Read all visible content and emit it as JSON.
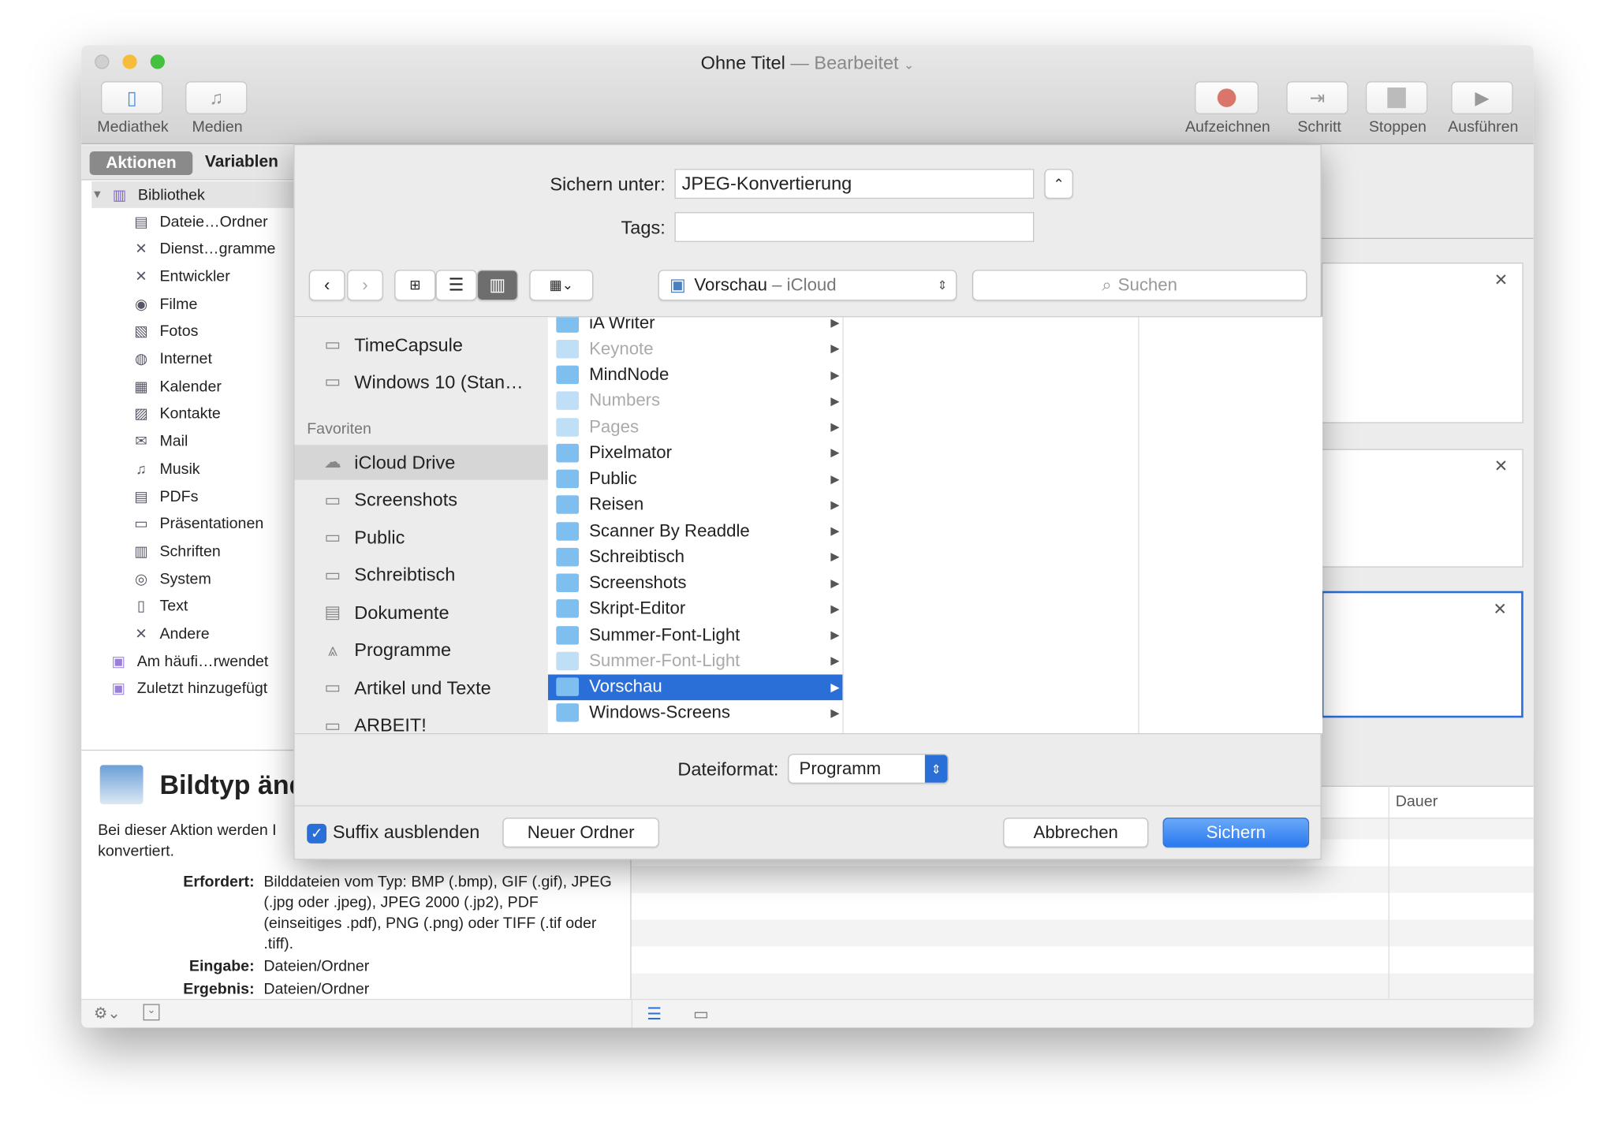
{
  "window": {
    "title": "Ohne Titel",
    "title_sep": " — ",
    "status": "Bearbeitet",
    "status_chevron": "⌄"
  },
  "toolbar": {
    "left": [
      {
        "label": "Mediathek",
        "icon": "sidebar-icon"
      },
      {
        "label": "Medien",
        "icon": "media-icon"
      }
    ],
    "right": [
      {
        "label": "Aufzeichnen",
        "icon": "record-icon"
      },
      {
        "label": "Schritt",
        "icon": "step-icon"
      },
      {
        "label": "Stoppen",
        "icon": "stop-icon"
      },
      {
        "label": "Ausführen",
        "icon": "play-icon"
      }
    ]
  },
  "library": {
    "tabs": [
      "Aktionen",
      "Variablen"
    ],
    "root": "Bibliothek",
    "items": [
      "Dateie…Ordner",
      "Dienst…gramme",
      "Entwickler",
      "Filme",
      "Fotos",
      "Internet",
      "Kalender",
      "Kontakte",
      "Mail",
      "Musik",
      "PDFs",
      "Präsentationen",
      "Schriften",
      "System",
      "Text",
      "Andere"
    ],
    "smart": [
      "Am häufi…rwendet",
      "Zuletzt hinzugefügt"
    ]
  },
  "description": {
    "title": "Bildtyp änd",
    "text_1": "Bei dieser Aktion werden I",
    "text_2": "konvertiert.",
    "requires_label": "Erfordert:",
    "requires": "Bilddateien vom Typ: BMP (.bmp), GIF (.gif), JPEG (.jpg oder .jpeg), JPEG 2000 (.jp2), PDF (einseitiges .pdf), PNG (.png) oder TIFF (.tif oder .tiff).",
    "input_label": "Eingabe:",
    "input": "Dateien/Ordner",
    "result_label": "Ergebnis:",
    "result": "Dateien/Ordner"
  },
  "log": {
    "col_duration": "Dauer"
  },
  "dialog": {
    "save_as_label": "Sichern unter:",
    "save_as_value": "JPEG-Konvertierung",
    "tags_label": "Tags:",
    "tags_value": "",
    "location": "Vorschau",
    "location_suffix": "– iCloud",
    "search_placeholder": "Suchen",
    "sidebar": {
      "devices": [
        "TimeCapsule",
        "Windows 10 (Stan…"
      ],
      "favorites_header": "Favoriten",
      "favorites": [
        "iCloud Drive",
        "Screenshots",
        "Public",
        "Schreibtisch",
        "Dokumente",
        "Programme",
        "Artikel und Texte",
        "ARBEIT!"
      ],
      "selected": "iCloud Drive"
    },
    "column": [
      {
        "name": "iA Writer",
        "dim": false
      },
      {
        "name": "Keynote",
        "dim": true
      },
      {
        "name": "MindNode",
        "dim": false
      },
      {
        "name": "Numbers",
        "dim": true
      },
      {
        "name": "Pages",
        "dim": true
      },
      {
        "name": "Pixelmator",
        "dim": false
      },
      {
        "name": "Public",
        "dim": false
      },
      {
        "name": "Reisen",
        "dim": false
      },
      {
        "name": "Scanner By Readdle",
        "dim": false
      },
      {
        "name": "Schreibtisch",
        "dim": false
      },
      {
        "name": "Screenshots",
        "dim": false
      },
      {
        "name": "Skript-Editor",
        "dim": false
      },
      {
        "name": "Summer-Font-Light",
        "dim": false
      },
      {
        "name": "Summer-Font-Light",
        "dim": true
      },
      {
        "name": "Vorschau",
        "dim": false,
        "selected": true
      },
      {
        "name": "Windows-Screens",
        "dim": false
      }
    ],
    "format_label": "Dateiformat:",
    "format_value": "Programm",
    "hide_suffix_label": "Suffix ausblenden",
    "hide_suffix_checked": true,
    "new_folder": "Neuer Ordner",
    "cancel": "Abbrechen",
    "save": "Sichern"
  },
  "colors": {
    "accent": "#2a6fd8",
    "record": "#d9756a"
  }
}
